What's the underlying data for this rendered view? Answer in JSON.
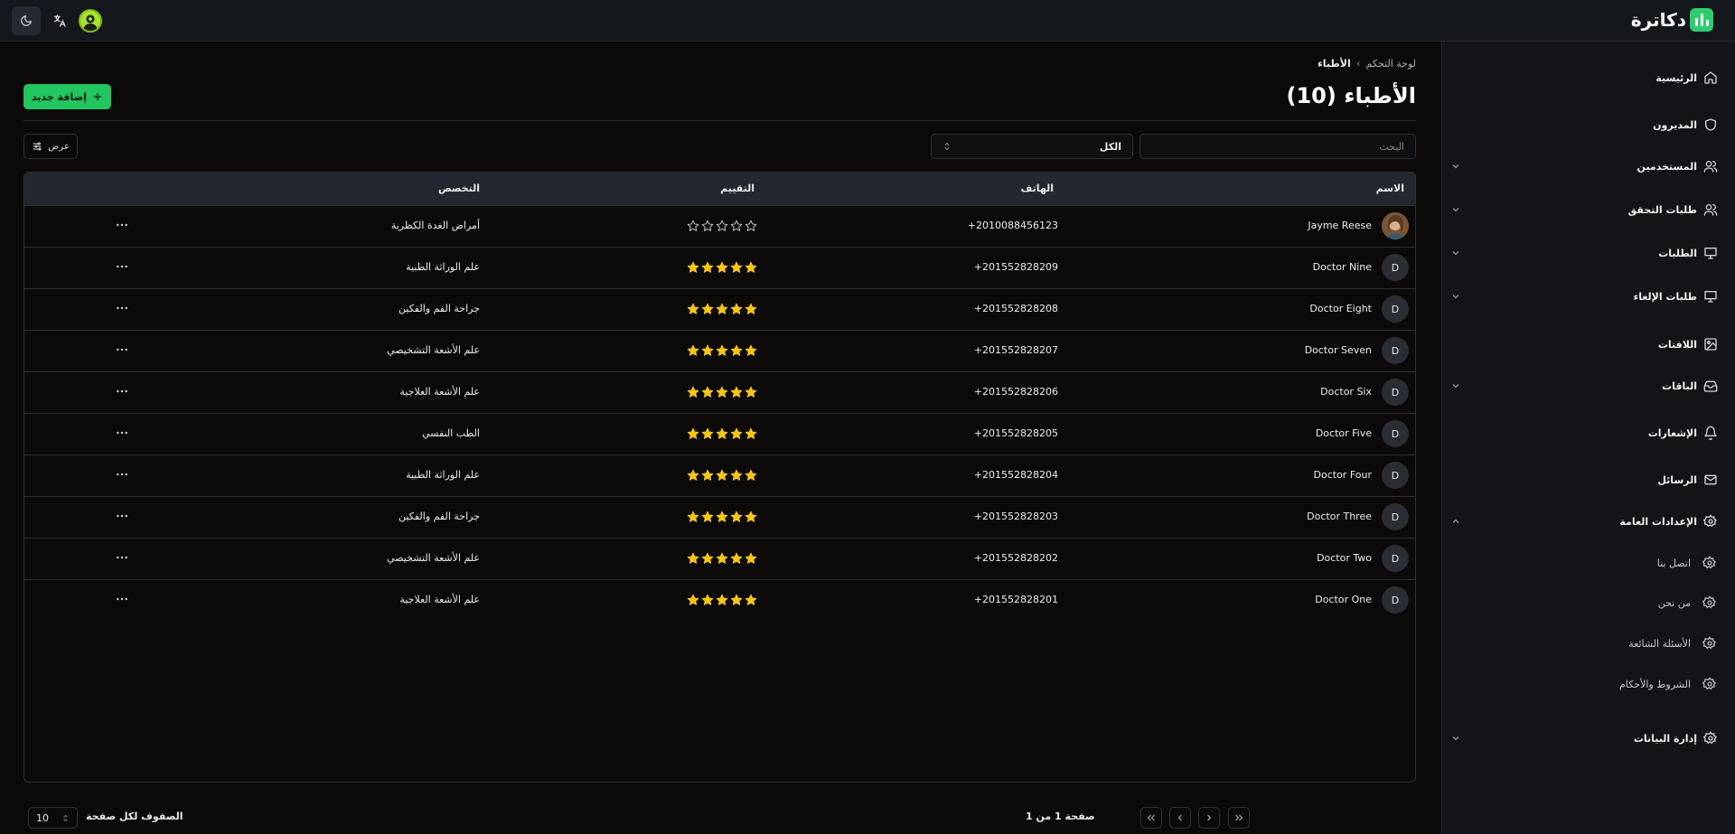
{
  "brand": {
    "name": "دكاترة"
  },
  "sidebar": {
    "items": [
      {
        "label": "الرئيسية",
        "icon": "home-icon"
      },
      {
        "label": "المديرون",
        "icon": "shield-icon"
      },
      {
        "label": "المستخدمين",
        "icon": "users-icon",
        "expandable": true
      },
      {
        "label": "طلبات التحقق",
        "icon": "users-icon",
        "expandable": true
      },
      {
        "label": "الطلبات",
        "icon": "presentation-icon",
        "expandable": true
      },
      {
        "label": "طلبات الإلغاء",
        "icon": "presentation-icon",
        "expandable": true
      },
      {
        "label": "اللافتات",
        "icon": "image-icon"
      },
      {
        "label": "الباقات",
        "icon": "inbox-icon",
        "expandable": true
      },
      {
        "label": "الإشعارات",
        "icon": "bell-icon"
      },
      {
        "label": "الرسائل",
        "icon": "mail-icon"
      },
      {
        "label": "الإعدادات العامة",
        "icon": "gear-icon",
        "expanded": true
      },
      {
        "label": "إدارة البيانات",
        "icon": "gear-icon",
        "expandable": true
      }
    ],
    "settings_sub": [
      {
        "label": "اتصل بنا",
        "icon": "gear-icon"
      },
      {
        "label": "من نحن",
        "icon": "gear-icon"
      },
      {
        "label": "الأسئلة الشائعة",
        "icon": "gear-icon"
      },
      {
        "label": "الشروط والأحكام",
        "icon": "gear-icon"
      }
    ]
  },
  "breadcrumb": {
    "home": "لوحة التحكم",
    "separator": "›",
    "current": "الأطباء"
  },
  "page": {
    "title": "الأطباء (10)",
    "add_label": "إضافة جديد"
  },
  "toolbar": {
    "search_placeholder": "البحث",
    "filter_value": "الكل",
    "view_label": "عرض"
  },
  "table": {
    "columns": {
      "name": "الاسم",
      "phone": "الهاتف",
      "rating": "التقييم",
      "specialty": "التخصص"
    },
    "rows": [
      {
        "avatar": "",
        "name": "Jayme Reese",
        "phone": "+2010088456123",
        "stars": 0,
        "specialty": "أمراض الغدة الكظرية"
      },
      {
        "avatar": "D",
        "name": "Doctor Nine",
        "phone": "+201552828209",
        "stars": 5,
        "specialty": "علم الوراثة الطبية"
      },
      {
        "avatar": "D",
        "name": "Doctor Eight",
        "phone": "+201552828208",
        "stars": 5,
        "specialty": "جراحة الفم والفكين"
      },
      {
        "avatar": "D",
        "name": "Doctor Seven",
        "phone": "+201552828207",
        "stars": 5,
        "specialty": "علم الأشعة التشخيصي"
      },
      {
        "avatar": "D",
        "name": "Doctor Six",
        "phone": "+201552828206",
        "stars": 5,
        "specialty": "علم الأشعة العلاجية"
      },
      {
        "avatar": "D",
        "name": "Doctor Five",
        "phone": "+201552828205",
        "stars": 5,
        "specialty": "الطب النفسي"
      },
      {
        "avatar": "D",
        "name": "Doctor Four",
        "phone": "+201552828204",
        "stars": 5,
        "specialty": "علم الوراثة الطبية"
      },
      {
        "avatar": "D",
        "name": "Doctor Three",
        "phone": "+201552828203",
        "stars": 5,
        "specialty": "جراحة الفم والفكين"
      },
      {
        "avatar": "D",
        "name": "Doctor Two",
        "phone": "+201552828202",
        "stars": 5,
        "specialty": "علم الأشعة التشخيصي"
      },
      {
        "avatar": "D",
        "name": "Doctor One",
        "phone": "+201552828201",
        "stars": 5,
        "specialty": "علم الأشعة العلاجية"
      }
    ]
  },
  "pagination": {
    "rows_label": "الصفوف لكل صفحة",
    "rows_value": "10",
    "page_info": "صفحة 1 من 1"
  },
  "colors": {
    "accent": "#22c55e",
    "star": "#f5c518",
    "background": "#0b0a09",
    "sidebar": "#121418"
  }
}
